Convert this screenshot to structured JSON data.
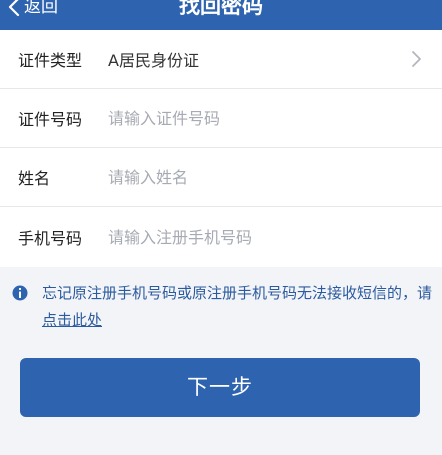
{
  "header": {
    "back_label": "返回",
    "title": "找回密码"
  },
  "form": {
    "id_type": {
      "label": "证件类型",
      "value": "A居民身份证"
    },
    "id_number": {
      "label": "证件号码",
      "placeholder": "请输入证件号码"
    },
    "name": {
      "label": "姓名",
      "placeholder": "请输入姓名"
    },
    "phone": {
      "label": "手机号码",
      "placeholder": "请输入注册手机号码"
    }
  },
  "notice": {
    "text": "忘记原注册手机号码或原注册手机号码无法接收短信的，请",
    "link": "点击此处"
  },
  "actions": {
    "next_label": "下一步"
  },
  "colors": {
    "primary": "#2e63b0",
    "notice_text": "#2b5a9f",
    "page_bg": "#f2f4f7"
  },
  "icons": {
    "back": "chevron-left-icon",
    "row_arrow": "chevron-right-icon",
    "notice": "info-icon"
  }
}
